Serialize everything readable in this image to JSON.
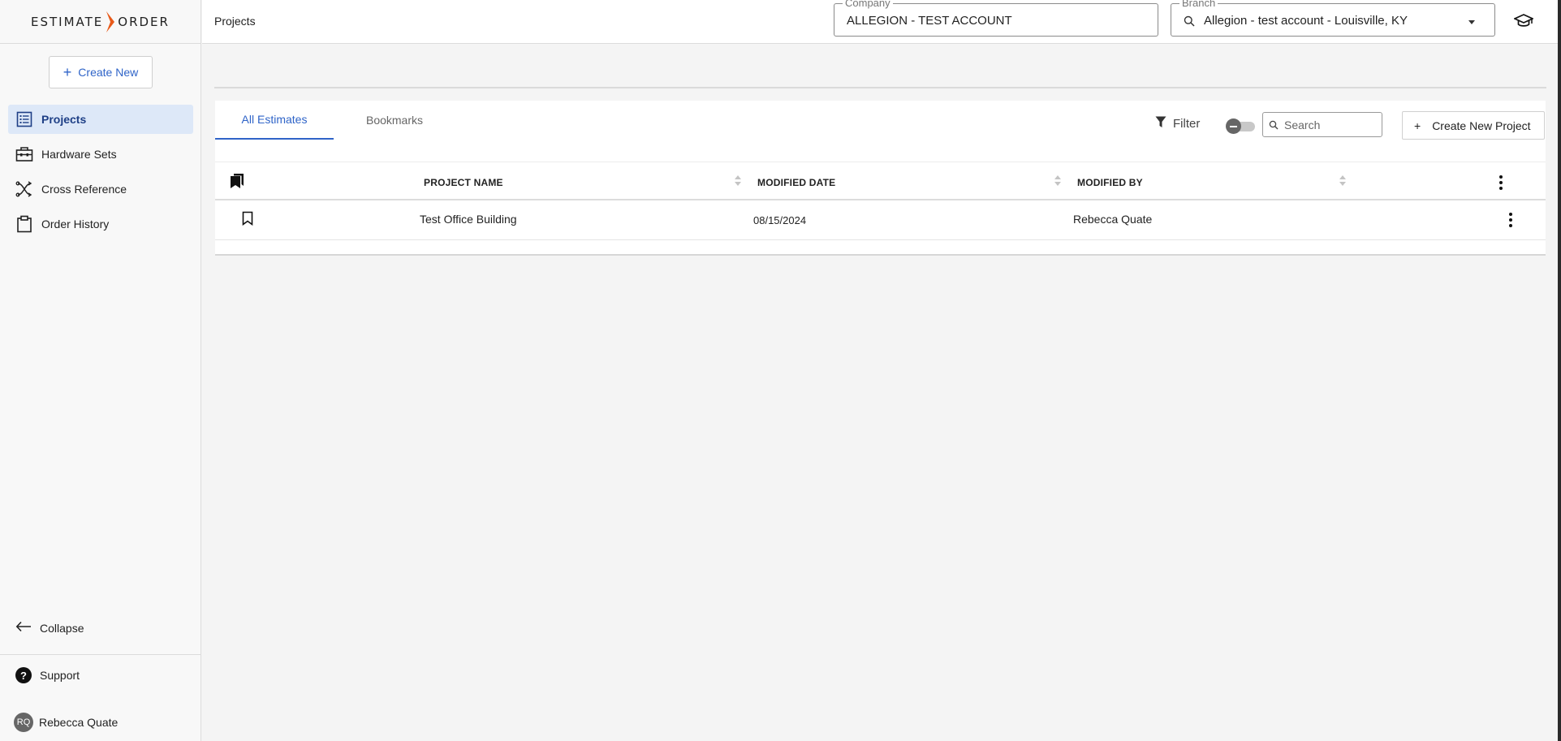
{
  "app": {
    "logo_left": "ESTIMATE",
    "logo_right": "ORDER"
  },
  "sidebar": {
    "create_new": "Create New",
    "items": [
      {
        "label": "Projects",
        "icon": "list-icon",
        "active": true
      },
      {
        "label": "Hardware Sets",
        "icon": "toolbox-icon",
        "active": false
      },
      {
        "label": "Cross Reference",
        "icon": "cross-reference-icon",
        "active": false
      },
      {
        "label": "Order History",
        "icon": "clipboard-icon",
        "active": false
      }
    ],
    "collapse": "Collapse",
    "support": "Support",
    "user": {
      "initials": "RQ",
      "name": "Rebecca Quate"
    }
  },
  "header": {
    "breadcrumb": "Projects",
    "company": {
      "label": "Company",
      "value": "ALLEGION - TEST ACCOUNT"
    },
    "branch": {
      "label": "Branch",
      "value": "Allegion - test account - Louisville, KY"
    }
  },
  "main": {
    "tabs": [
      {
        "label": "All Estimates",
        "active": true
      },
      {
        "label": "Bookmarks",
        "active": false
      }
    ],
    "filter_label": "Filter",
    "search_placeholder": "Search",
    "create_project": "Create New Project",
    "table": {
      "columns": [
        "PROJECT NAME",
        "MODIFIED DATE",
        "MODIFIED BY"
      ],
      "rows": [
        {
          "project_name": "Test Office Building",
          "modified_date": "08/15/2024",
          "modified_by": "Rebecca Quate"
        }
      ]
    }
  },
  "colors": {
    "accent": "#2f64c8",
    "logo_chevron": "#e85a1a",
    "active_nav_bg": "#dde8f8"
  }
}
